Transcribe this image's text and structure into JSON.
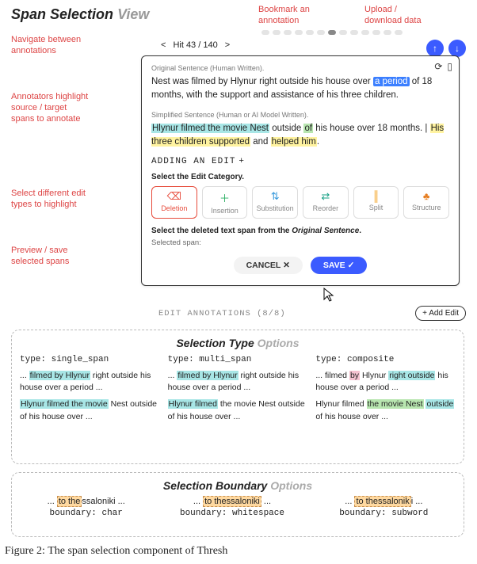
{
  "header": {
    "title_main": "Span Selection",
    "title_gray": "View"
  },
  "redlabels": {
    "bookmark": "Bookmark an\nannotation",
    "updown": "Upload /\ndownload data",
    "nav": "Navigate between\nannotations",
    "highlight": "Annotators highlight\nsource / target\nspans to annotate",
    "edittypes": "Select different edit\ntypes to highlight",
    "preview": "Preview / save\nselected spans"
  },
  "nav": {
    "prev": "<",
    "hit": "Hit 43 / 140",
    "next": ">"
  },
  "card": {
    "orig_hdr": "Original Sentence (Human Written).",
    "orig_pre": "Nest was filmed by Hlynur right outside his house over ",
    "orig_hl": "a period",
    "orig_post": " of 18 months, with the support and assistance of his three children.",
    "simp_hdr": "Simplified Sentence (Human or AI Model Written).",
    "simp_s1a": "Hlynur filmed the movie Nest",
    "simp_s1b": " outside ",
    "simp_s1c": "of",
    "simp_s1d": " his house over 18 months.",
    "simp_s2a": "His three children supported",
    "simp_s2b": " and ",
    "simp_s2c": "helped him",
    "simp_s2d": ".",
    "adding": "ADDING AN EDIT",
    "plus": "+",
    "select_cat": "Select the Edit Category.",
    "cats": {
      "del": "Deletion",
      "ins": "Insertion",
      "sub": "Substitution",
      "reo": "Reorder",
      "spl": "Split",
      "str": "Structure"
    },
    "instr_pre": "Select the deleted text span from the ",
    "instr_ital": "Original Sentence",
    "instr_post": ".",
    "selspan": "Selected span:",
    "cancel": "CANCEL ✕",
    "save": "SAVE ✓"
  },
  "anno_line": "EDIT ANNOTATIONS (8/8)",
  "addedit": "+ Add Edit",
  "panel1": {
    "title_main": "Selection Type",
    "title_gray": "Options",
    "c1": {
      "type": "type: single_span",
      "l1a": "... ",
      "l1b": "filmed by Hlynur",
      "l1c": " right outside his house over a period ...",
      "l2a": "Hlynur filmed the movie",
      "l2b": " Nest outside of his house over ..."
    },
    "c2": {
      "type": "type: multi_span",
      "l1a": "... ",
      "l1b": "filmed by Hlynur",
      "l1c": " right outside his house over a period ...",
      "l2a": "Hlynur filmed",
      "l2b": " the movie Nest outside of his house over ..."
    },
    "c3": {
      "type": "type: composite",
      "l1a": "... filmed ",
      "l1b": "by",
      "l1c": " Hlynur ",
      "l1d": "right outside",
      "l1e": " his house over a period ...",
      "l2a": "Hlynur filmed ",
      "l2b": "the movie Nest",
      "l2c": " ",
      "l2d": "outside",
      "l2e": " of his house over ..."
    }
  },
  "panel2": {
    "title_main": "Selection Boundary",
    "title_gray": "Options",
    "c1": {
      "text": "... to thessaloniki ...",
      "b": "boundary: char"
    },
    "c2": {
      "text": "... to thessaloniki ...",
      "b": "boundary: whitespace"
    },
    "c3": {
      "text": "... to thessaloniki ...",
      "b": "boundary: subword"
    }
  },
  "caption": "Figure 2: The span selection component of Thresh"
}
